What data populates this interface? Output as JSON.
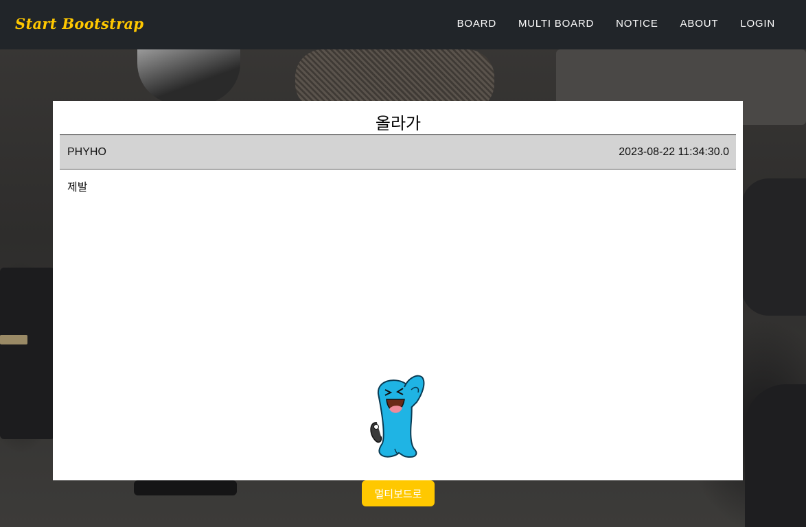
{
  "navbar": {
    "brand": "Start Bootstrap",
    "links": [
      {
        "label": "BOARD"
      },
      {
        "label": "MULTI BOARD"
      },
      {
        "label": "NOTICE"
      },
      {
        "label": "ABOUT"
      },
      {
        "label": "LOGIN"
      }
    ]
  },
  "post": {
    "title": "올라가",
    "author": "PHYHO",
    "date": "2023-08-22 11:34:30.0",
    "content": "제발",
    "image_icon": "wobbuffet-character-image"
  },
  "actions": {
    "back_label": "멀티보드로"
  },
  "colors": {
    "navbar_bg": "#212529",
    "brand": "#ffc800",
    "button_bg": "#ffc800",
    "meta_row_bg": "#d3d3d3",
    "character_body": "#1fb4e4"
  }
}
